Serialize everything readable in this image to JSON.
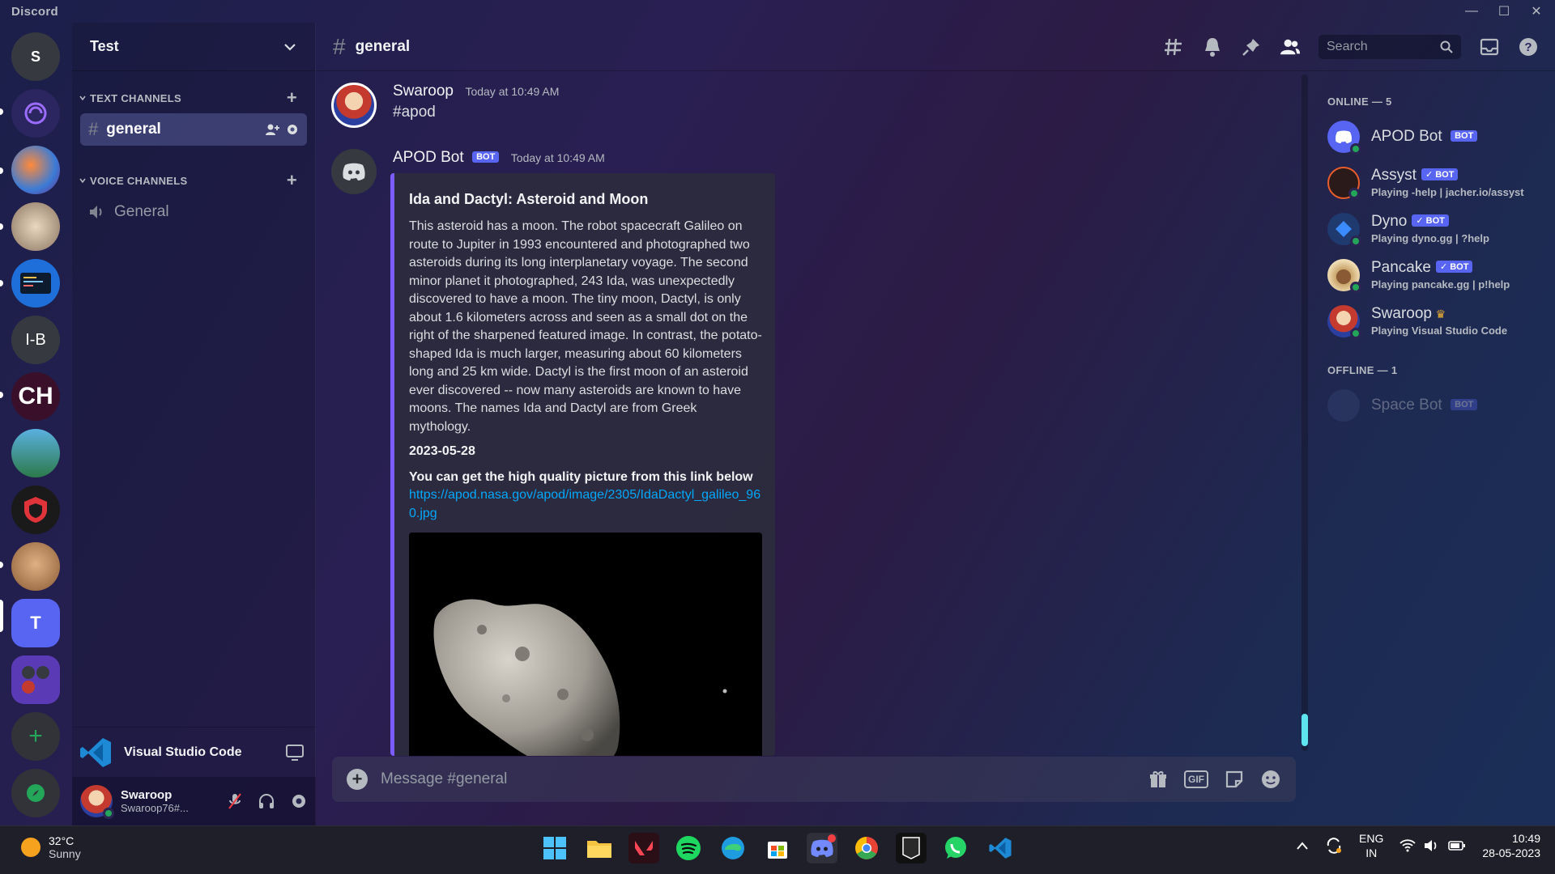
{
  "window": {
    "app_name": "Discord",
    "controls": [
      "—",
      "☐",
      "✕"
    ]
  },
  "servers": [
    {
      "label": "S",
      "color": "#36393f"
    },
    {
      "label": "",
      "color": "#2b2560"
    },
    {
      "label": "",
      "color": "#5b3b7a"
    },
    {
      "label": "",
      "color": "#c9b79a"
    },
    {
      "label": "",
      "color": "#1e6fd9"
    },
    {
      "label": "I-B",
      "color": "#36393f"
    },
    {
      "label": "CH",
      "color": "#3a0f2a"
    },
    {
      "label": "",
      "color": "#4b8fb3"
    },
    {
      "label": "",
      "color": "#1a1a1a"
    },
    {
      "label": "",
      "color": "#c88957"
    },
    {
      "label": "T",
      "color": "#5865f2"
    },
    {
      "label": "",
      "color": "#5b3bb5"
    }
  ],
  "guild": {
    "name": "Test"
  },
  "categories": {
    "text": "TEXT CHANNELS",
    "voice": "VOICE CHANNELS"
  },
  "channels": {
    "text": [
      {
        "name": "general"
      }
    ],
    "voice": [
      {
        "name": "General"
      }
    ]
  },
  "activity": {
    "name": "Visual Studio Code"
  },
  "user": {
    "name": "Swaroop",
    "tag": "Swaroop76#..."
  },
  "header": {
    "channel": "general",
    "search_placeholder": "Search"
  },
  "messages": [
    {
      "author": "Swaroop",
      "time": "Today at 10:49 AM",
      "content": "#apod"
    },
    {
      "author": "APOD Bot",
      "bot_tag": "BOT",
      "time": "Today at 10:49 AM"
    }
  ],
  "embed": {
    "title": "Ida and Dactyl: Asteroid and Moon",
    "description": "This asteroid has a moon. The robot spacecraft Galileo on route to Jupiter in 1993 encountered and photographed two asteroids during its long interplanetary voyage. The second minor planet it photographed, 243 Ida, was unexpectedly discovered to have a moon. The tiny moon, Dactyl, is only about 1.6 kilometers across and seen as a small dot on the right of the sharpened featured image. In contrast, the potato-shaped Ida is much larger, measuring about 60 kilometers long and 25 km wide. Dactyl is the first moon of an asteroid ever discovered -- now many asteroids are known to have moons. The names Ida and Dactyl are from Greek mythology.",
    "date": "2023-05-28",
    "field": "You can get the high quality picture from this link below",
    "link": "https://apod.nasa.gov/apod/image/2305/IdaDactyl_galileo_960.jpg"
  },
  "composer": {
    "placeholder": "Message #general"
  },
  "members": {
    "online_title": "ONLINE — 5",
    "offline_title": "OFFLINE — 1",
    "online": [
      {
        "name": "APOD Bot",
        "tag": "BOT",
        "activity": "",
        "color": "#5865f2"
      },
      {
        "name": "Assyst",
        "tag": "✓ BOT",
        "activity": "Playing -help | jacher.io/assyst",
        "color": "#2b1a1a"
      },
      {
        "name": "Dyno",
        "tag": "✓ BOT",
        "activity": "Playing dyno.gg | ?help",
        "color": "#1e3a6e"
      },
      {
        "name": "Pancake",
        "tag": "✓ BOT",
        "activity": "Playing pancake.gg | p!help",
        "color": "#c9a46a"
      },
      {
        "name": "Swaroop",
        "tag": "",
        "crown": "♛",
        "activity": "Playing Visual Studio Code",
        "color": "#c43a2e"
      }
    ],
    "offline": [
      {
        "name": "Space Bot",
        "tag": "BOT",
        "color": "#3a4a7a"
      }
    ]
  },
  "taskbar": {
    "weather_temp": "32°C",
    "weather_desc": "Sunny",
    "lang": "ENG",
    "region": "IN",
    "time": "10:49",
    "date": "28-05-2023"
  }
}
